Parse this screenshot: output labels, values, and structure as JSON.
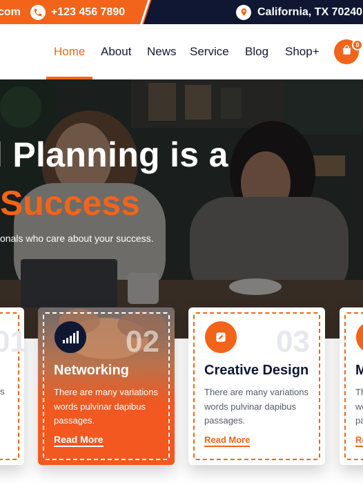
{
  "topbar": {
    "email_fragment": "com",
    "phone": "+123 456 7890",
    "location": "California, TX 70240"
  },
  "nav": {
    "items": [
      {
        "label": "Home",
        "active": true
      },
      {
        "label": "About"
      },
      {
        "label": "News"
      },
      {
        "label": "Service"
      },
      {
        "label": "Blog"
      },
      {
        "label": "Shop"
      }
    ],
    "shop_plus": "+",
    "cart_count": "0"
  },
  "hero": {
    "title_line1": "l Planning is a",
    "title_line2": "Success",
    "subtitle": "onals who care about your success."
  },
  "cards": [
    {
      "number": "01",
      "title": "",
      "desc": "s",
      "link": ""
    },
    {
      "number": "02",
      "title": "Networking",
      "desc": "There are many variations words pulvinar dapibus passages.",
      "link": "Read More"
    },
    {
      "number": "03",
      "title": "Creative Design",
      "desc": "There are many variations words pulvinar dapibus passages.",
      "link": "Read More"
    },
    {
      "number": "",
      "title": "M",
      "desc": "Th\nwo\npa",
      "link": "Re"
    }
  ],
  "colors": {
    "accent": "#f26419",
    "navy": "#0f1733"
  }
}
